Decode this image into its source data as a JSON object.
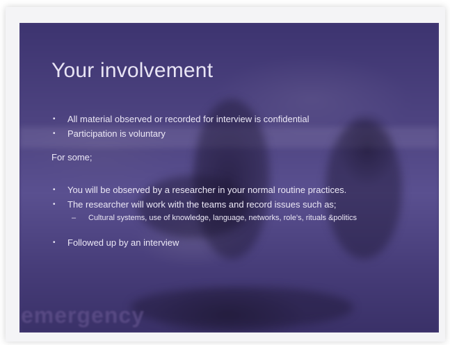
{
  "slide": {
    "title": "Your involvement",
    "bullets_top": [
      "All material observed or recorded for interview is confidential",
      "Participation is voluntary"
    ],
    "plain_text": "For some;",
    "bullets_middle": [
      "You will be observed by a researcher in your normal routine practices.",
      "The researcher will work with the teams and record issues such as;"
    ],
    "sub_bullet": "Cultural systems, use of knowledge, language, networks, role's, rituals &politics",
    "bullets_bottom": [
      "Followed up by an interview"
    ],
    "watermark": "emergency",
    "bullet_glyph": "•",
    "dash_glyph": "–"
  },
  "colors": {
    "slide_tint": "#4a3f78",
    "text": "#ece8f6"
  }
}
